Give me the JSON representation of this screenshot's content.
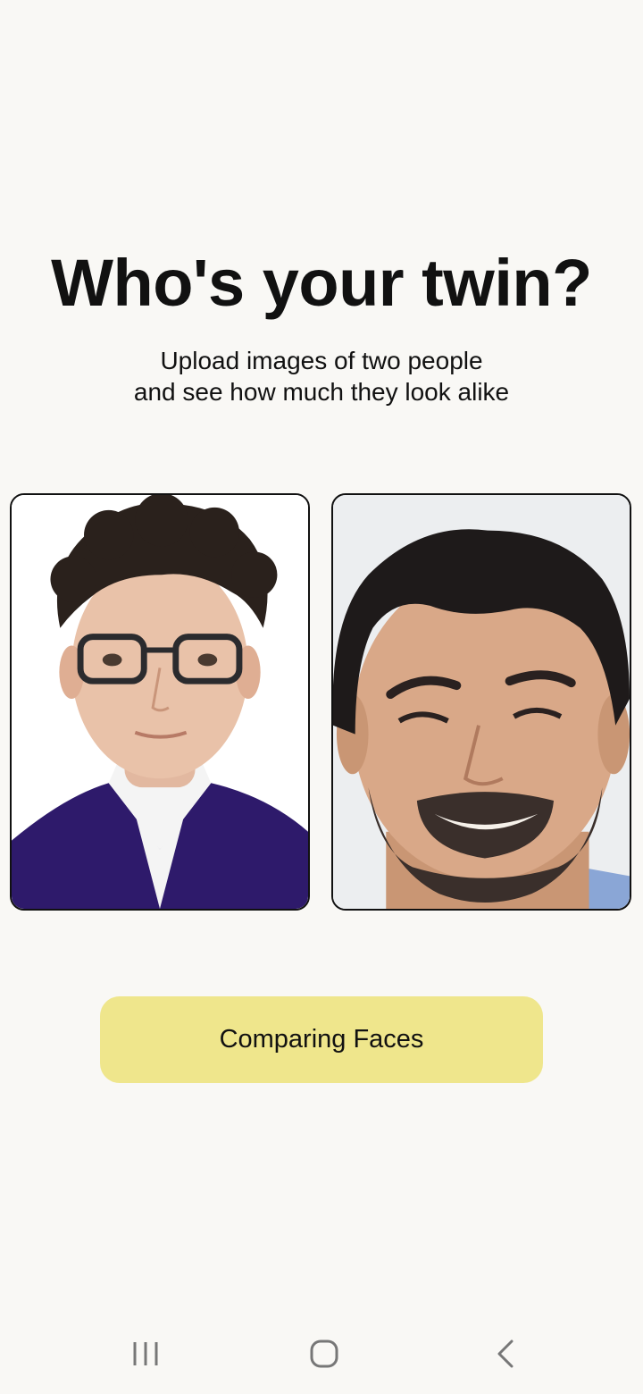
{
  "header": {
    "title": "Who's your twin?",
    "subtitle_line1": "Upload images of two people",
    "subtitle_line2": "and see how much they look alike"
  },
  "photos": [
    {
      "slot": "left",
      "icon": "person-photo-glasses"
    },
    {
      "slot": "right",
      "icon": "person-photo-beard"
    }
  ],
  "action": {
    "button_label": "Comparing Faces",
    "button_color": "#efe68c"
  },
  "nav": {
    "recents_icon": "recents-icon",
    "home_icon": "home-icon",
    "back_icon": "back-icon"
  },
  "colors": {
    "background": "#f9f8f5",
    "text": "#111111"
  }
}
